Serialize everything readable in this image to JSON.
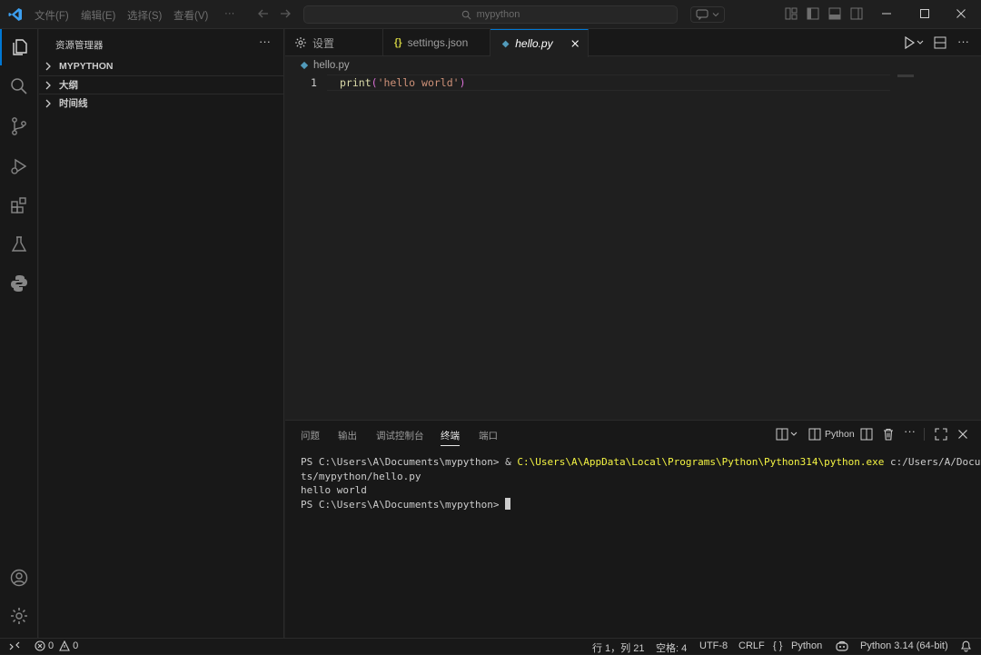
{
  "titlebar": {
    "menus": [
      "文件(F)",
      "编辑(E)",
      "选择(S)",
      "查看(V)",
      "···"
    ],
    "search_text": "mypython"
  },
  "sidebar": {
    "title": "资源管理器",
    "more": "···",
    "sections": [
      {
        "label": "MYPYTHON"
      },
      {
        "label": "大纲"
      },
      {
        "label": "时间线"
      }
    ]
  },
  "tabs": [
    {
      "label": "设置",
      "icon": "gear-icon"
    },
    {
      "label": "settings.json",
      "icon": "json-braces-icon",
      "icon_text": "{}"
    },
    {
      "label": "hello.py",
      "icon": "python-file-icon",
      "active": true
    }
  ],
  "editor": {
    "breadcrumb": "hello.py",
    "line_number": "1",
    "code": {
      "fn": "print",
      "open": "(",
      "str": "'hello world'",
      "close": ")"
    }
  },
  "panel": {
    "tabs": [
      "问题",
      "输出",
      "调试控制台",
      "终端",
      "端口"
    ],
    "active_tab": "终端",
    "shell_label": "Python",
    "terminal": {
      "line1_prompt": "PS C:\\Users\\A\\Documents\\mypython> & ",
      "line1_exe": "C:\\Users\\A\\AppData\\Local\\Programs\\Python\\Python314\\python.exe",
      "line1_arg": " c:/Users/A/Documen",
      "line2": "ts/mypython/hello.py",
      "line3": "hello world",
      "line4_prompt": "PS C:\\Users\\A\\Documents\\mypython> "
    }
  },
  "statusbar": {
    "errors": "0",
    "warnings": "0",
    "position": "行 1，列 21",
    "spaces": "空格: 4",
    "encoding": "UTF-8",
    "eol": "CRLF",
    "braces": "{ }",
    "language": "Python",
    "interpreter": "Python 3.14 (64-bit)"
  },
  "colors": {
    "accent": "#0078d4",
    "background": "#1f1f1f",
    "sidebar": "#181818",
    "string": "#ce9178",
    "function": "#dcdcaa",
    "terminal_yellow": "#f5f543"
  }
}
